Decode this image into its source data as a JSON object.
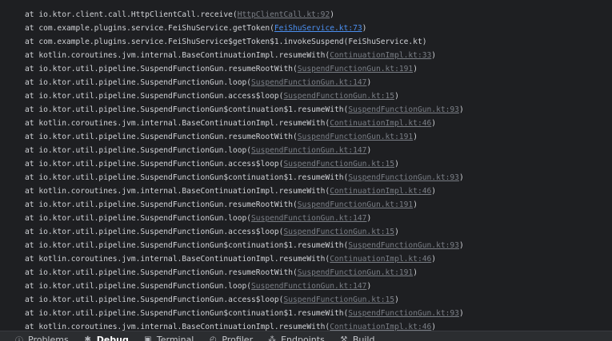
{
  "console": {
    "lines": [
      {
        "prefix": "at io.ktor.client.call.HttpClientCall.receive(",
        "link": "HttpClientCall.kt:92",
        "suffix": ")",
        "active": false
      },
      {
        "prefix": "at com.example.plugins.service.FeiShuService.getToken(",
        "link": "FeiShuService.kt:73",
        "suffix": ")",
        "active": true
      },
      {
        "prefix": "at com.example.plugins.service.FeiShuService$getToken$1.invokeSuspend(FeiShuService.kt)",
        "link": "",
        "suffix": "",
        "active": false
      },
      {
        "prefix": "at kotlin.coroutines.jvm.internal.BaseContinuationImpl.resumeWith(",
        "link": "ContinuationImpl.kt:33",
        "suffix": ")",
        "active": false
      },
      {
        "prefix": "at io.ktor.util.pipeline.SuspendFunctionGun.resumeRootWith(",
        "link": "SuspendFunctionGun.kt:191",
        "suffix": ")",
        "active": false
      },
      {
        "prefix": "at io.ktor.util.pipeline.SuspendFunctionGun.loop(",
        "link": "SuspendFunctionGun.kt:147",
        "suffix": ")",
        "active": false
      },
      {
        "prefix": "at io.ktor.util.pipeline.SuspendFunctionGun.access$loop(",
        "link": "SuspendFunctionGun.kt:15",
        "suffix": ")",
        "active": false
      },
      {
        "prefix": "at io.ktor.util.pipeline.SuspendFunctionGun$continuation$1.resumeWith(",
        "link": "SuspendFunctionGun.kt:93",
        "suffix": ")",
        "active": false
      },
      {
        "prefix": "at kotlin.coroutines.jvm.internal.BaseContinuationImpl.resumeWith(",
        "link": "ContinuationImpl.kt:46",
        "suffix": ")",
        "active": false
      },
      {
        "prefix": "at io.ktor.util.pipeline.SuspendFunctionGun.resumeRootWith(",
        "link": "SuspendFunctionGun.kt:191",
        "suffix": ")",
        "active": false
      },
      {
        "prefix": "at io.ktor.util.pipeline.SuspendFunctionGun.loop(",
        "link": "SuspendFunctionGun.kt:147",
        "suffix": ")",
        "active": false
      },
      {
        "prefix": "at io.ktor.util.pipeline.SuspendFunctionGun.access$loop(",
        "link": "SuspendFunctionGun.kt:15",
        "suffix": ")",
        "active": false
      },
      {
        "prefix": "at io.ktor.util.pipeline.SuspendFunctionGun$continuation$1.resumeWith(",
        "link": "SuspendFunctionGun.kt:93",
        "suffix": ")",
        "active": false
      },
      {
        "prefix": "at kotlin.coroutines.jvm.internal.BaseContinuationImpl.resumeWith(",
        "link": "ContinuationImpl.kt:46",
        "suffix": ")",
        "active": false
      },
      {
        "prefix": "at io.ktor.util.pipeline.SuspendFunctionGun.resumeRootWith(",
        "link": "SuspendFunctionGun.kt:191",
        "suffix": ")",
        "active": false
      },
      {
        "prefix": "at io.ktor.util.pipeline.SuspendFunctionGun.loop(",
        "link": "SuspendFunctionGun.kt:147",
        "suffix": ")",
        "active": false
      },
      {
        "prefix": "at io.ktor.util.pipeline.SuspendFunctionGun.access$loop(",
        "link": "SuspendFunctionGun.kt:15",
        "suffix": ")",
        "active": false
      },
      {
        "prefix": "at io.ktor.util.pipeline.SuspendFunctionGun$continuation$1.resumeWith(",
        "link": "SuspendFunctionGun.kt:93",
        "suffix": ")",
        "active": false
      },
      {
        "prefix": "at kotlin.coroutines.jvm.internal.BaseContinuationImpl.resumeWith(",
        "link": "ContinuationImpl.kt:46",
        "suffix": ")",
        "active": false
      },
      {
        "prefix": "at io.ktor.util.pipeline.SuspendFunctionGun.resumeRootWith(",
        "link": "SuspendFunctionGun.kt:191",
        "suffix": ")",
        "active": false
      },
      {
        "prefix": "at io.ktor.util.pipeline.SuspendFunctionGun.loop(",
        "link": "SuspendFunctionGun.kt:147",
        "suffix": ")",
        "active": false
      },
      {
        "prefix": "at io.ktor.util.pipeline.SuspendFunctionGun.access$loop(",
        "link": "SuspendFunctionGun.kt:15",
        "suffix": ")",
        "active": false
      },
      {
        "prefix": "at io.ktor.util.pipeline.SuspendFunctionGun$continuation$1.resumeWith(",
        "link": "SuspendFunctionGun.kt:93",
        "suffix": ")",
        "active": false
      },
      {
        "prefix": "at kotlin.coroutines.jvm.internal.BaseContinuationImpl.resumeWith(",
        "link": "ContinuationImpl.kt:46",
        "suffix": ")",
        "active": false
      }
    ]
  },
  "toolwindow": {
    "tabs": [
      {
        "icon": "ⓘ",
        "icon_name": "problems-icon",
        "label": "Problems",
        "active": false
      },
      {
        "icon": "✱",
        "icon_name": "debug-icon",
        "label": "Debug",
        "active": true
      },
      {
        "icon": "▣",
        "icon_name": "terminal-icon",
        "label": "Terminal",
        "active": false
      },
      {
        "icon": "◴",
        "icon_name": "profiler-icon",
        "label": "Profiler",
        "active": false
      },
      {
        "icon": "⁂",
        "icon_name": "endpoints-icon",
        "label": "Endpoints",
        "active": false
      },
      {
        "icon": "⚒",
        "icon_name": "build-icon",
        "label": "Build",
        "active": false
      }
    ]
  },
  "colors": {
    "background": "#1e1f22",
    "text": "#d0d2d6",
    "link": "#7a7e85",
    "link_active": "#4b8ff0",
    "toolbar": "#2b2d30"
  }
}
